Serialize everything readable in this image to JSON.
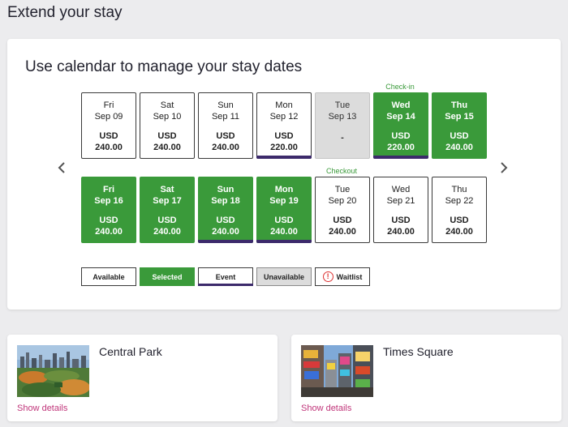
{
  "page": {
    "title": "Extend your stay"
  },
  "calendar": {
    "heading": "Use calendar to manage your stay dates",
    "prev_icon": "chevron-left-icon",
    "next_icon": "chevron-right-icon",
    "checkin_label": "Check-in",
    "checkout_label": "Checkout",
    "days": [
      {
        "dow": "Fri",
        "date": "Sep 09",
        "currency": "USD",
        "price": "240.00",
        "state": "available"
      },
      {
        "dow": "Sat",
        "date": "Sep 10",
        "currency": "USD",
        "price": "240.00",
        "state": "available"
      },
      {
        "dow": "Sun",
        "date": "Sep 11",
        "currency": "USD",
        "price": "240.00",
        "state": "available"
      },
      {
        "dow": "Mon",
        "date": "Sep 12",
        "currency": "USD",
        "price": "220.00",
        "state": "event"
      },
      {
        "dow": "Tue",
        "date": "Sep 13",
        "currency": "",
        "price": "-",
        "state": "unavailable"
      },
      {
        "dow": "Wed",
        "date": "Sep 14",
        "currency": "USD",
        "price": "220.00",
        "state": "selected-event"
      },
      {
        "dow": "Thu",
        "date": "Sep 15",
        "currency": "USD",
        "price": "240.00",
        "state": "selected"
      },
      {
        "dow": "Fri",
        "date": "Sep 16",
        "currency": "USD",
        "price": "240.00",
        "state": "selected"
      },
      {
        "dow": "Sat",
        "date": "Sep 17",
        "currency": "USD",
        "price": "240.00",
        "state": "selected"
      },
      {
        "dow": "Sun",
        "date": "Sep 18",
        "currency": "USD",
        "price": "240.00",
        "state": "selected-event"
      },
      {
        "dow": "Mon",
        "date": "Sep 19",
        "currency": "USD",
        "price": "240.00",
        "state": "selected-event"
      },
      {
        "dow": "Tue",
        "date": "Sep 20",
        "currency": "USD",
        "price": "240.00",
        "state": "available"
      },
      {
        "dow": "Wed",
        "date": "Sep 21",
        "currency": "USD",
        "price": "240.00",
        "state": "available"
      },
      {
        "dow": "Thu",
        "date": "Sep 22",
        "currency": "USD",
        "price": "240.00",
        "state": "available"
      }
    ]
  },
  "legend": {
    "available": "Available",
    "selected": "Selected",
    "event": "Event",
    "unavailable": "Unavailable",
    "waitlist": "Waitlist",
    "waitlist_icon": "alert-circle-icon"
  },
  "attractions": [
    {
      "name": "Central Park",
      "link": "Show details",
      "image": "central-park-photo"
    },
    {
      "name": "Times Square",
      "link": "Show details",
      "image": "times-square-photo"
    }
  ],
  "colors": {
    "selected": "#3a9a3a",
    "event": "#3c2a6b",
    "unavailable": "#dcdcdc",
    "link": "#c0357a"
  }
}
